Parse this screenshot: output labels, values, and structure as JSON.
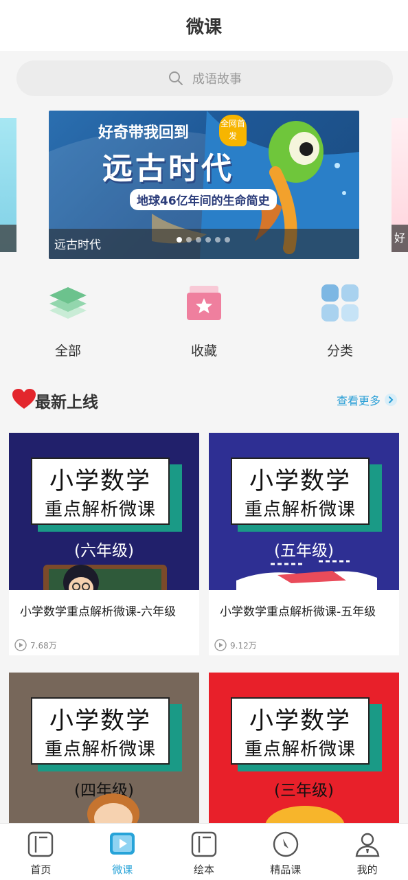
{
  "header": {
    "title": "微课"
  },
  "search": {
    "placeholder": "成语故事",
    "icon": "search-icon"
  },
  "banner": {
    "caption": "远古时代",
    "art_line1": "好奇带我回到",
    "art_line2": "远古时代",
    "art_line3": "地球46亿年间的生命简史",
    "art_badge": "全网首发",
    "right_peek_caption": "好",
    "dots_total": 6,
    "active_dot": 1
  },
  "quick_actions": [
    {
      "label": "全部",
      "icon": "layers-icon"
    },
    {
      "label": "收藏",
      "icon": "star-box-icon"
    },
    {
      "label": "分类",
      "icon": "grid-icon"
    }
  ],
  "section": {
    "icon": "heart-icon",
    "title": "最新上线",
    "more_label": "查看更多"
  },
  "courses": [
    {
      "title": "小学数学重点解析微课-六年级",
      "views": "7.68万",
      "cover_line1": "小学数学",
      "cover_line2": "重点解析微课",
      "cover_grade": "(六年级)",
      "cover_color": "#21206b"
    },
    {
      "title": "小学数学重点解析微课-五年级",
      "views": "9.12万",
      "cover_line1": "小学数学",
      "cover_line2": "重点解析微课",
      "cover_grade": "(五年级)",
      "cover_color": "#2e2f93"
    },
    {
      "title": "",
      "views": "",
      "cover_line1": "小学数学",
      "cover_line2": "重点解析微课",
      "cover_grade": "(四年级)",
      "cover_color": "#77675a"
    },
    {
      "title": "",
      "views": "",
      "cover_line1": "小学数学",
      "cover_line2": "重点解析微课",
      "cover_grade": "(三年级)",
      "cover_color": "#e8202a"
    }
  ],
  "tabbar": {
    "items": [
      {
        "label": "首页",
        "icon": "home-book-icon"
      },
      {
        "label": "微课",
        "icon": "video-play-icon"
      },
      {
        "label": "绘本",
        "icon": "picture-book-icon"
      },
      {
        "label": "精品课",
        "icon": "compass-icon"
      },
      {
        "label": "我的",
        "icon": "user-icon"
      }
    ],
    "active_index": 1,
    "active_color": "#27a3d8"
  }
}
